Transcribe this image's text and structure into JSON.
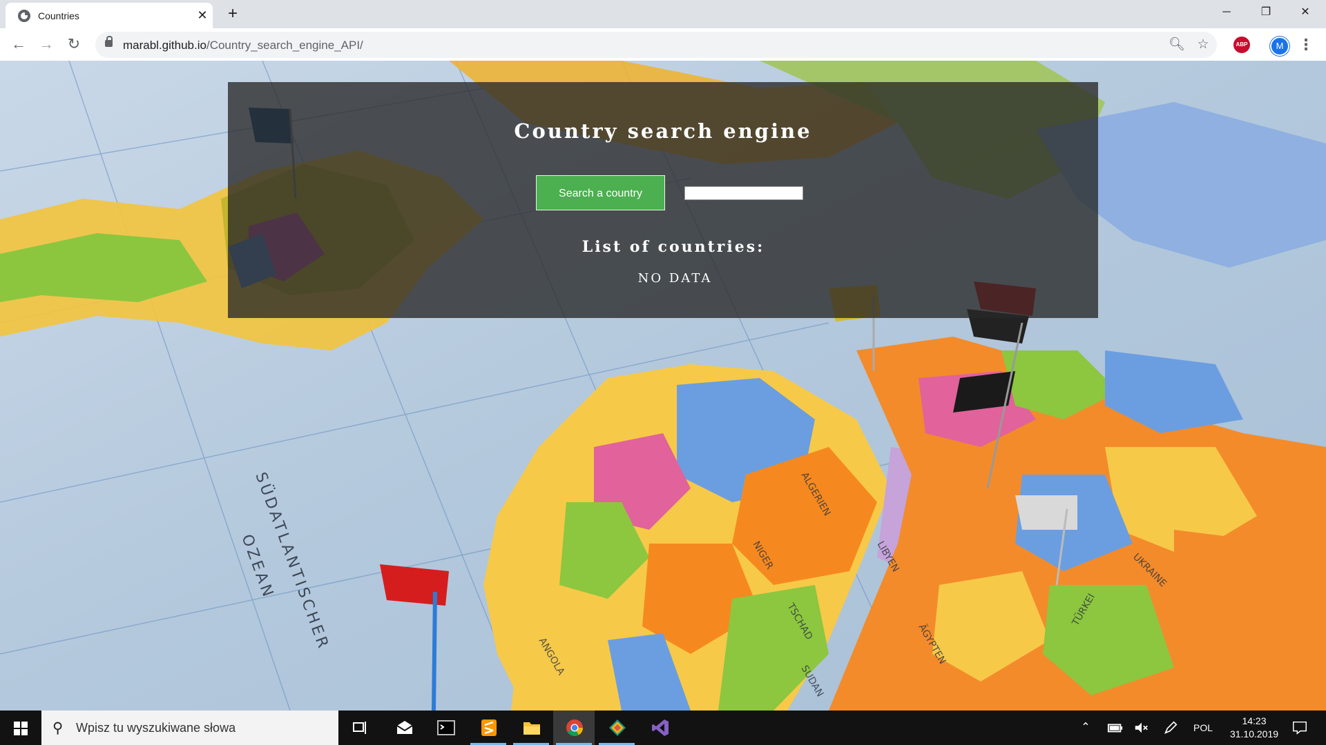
{
  "browser": {
    "tab_title": "Countries",
    "url_host": "marabl.github.io",
    "url_path": "/Country_search_engine_API/",
    "profile_initial": "M",
    "extension_badge": "ABP"
  },
  "page": {
    "title": "Country search engine",
    "search_button_label": "Search a country",
    "search_input_value": "",
    "list_heading": "List of countries:",
    "list_empty_text": "NO DATA"
  },
  "taskbar": {
    "search_placeholder": "Wpisz tu wyszukiwane słowa",
    "language": "POL",
    "time": "14:23",
    "date": "31.10.2019",
    "pinned_apps": [
      {
        "name": "Task View"
      },
      {
        "name": "Mail"
      },
      {
        "name": "Terminal"
      },
      {
        "name": "Sublime Text"
      },
      {
        "name": "File Explorer"
      },
      {
        "name": "Google Chrome"
      },
      {
        "name": "Git Kraken"
      },
      {
        "name": "Visual Studio"
      }
    ]
  },
  "colors": {
    "search_button": "#4caf50",
    "panel_overlay": "rgba(40,40,40,0.78)",
    "taskbar": "#121212"
  },
  "icons": {
    "tab_favicon": "globe-icon",
    "back": "arrow-left-icon",
    "forward": "arrow-right-icon",
    "reload": "reload-icon",
    "lock": "lock-icon",
    "zoom": "magnifier-icon",
    "bookmark": "star-icon",
    "menu": "kebab-menu-icon"
  }
}
